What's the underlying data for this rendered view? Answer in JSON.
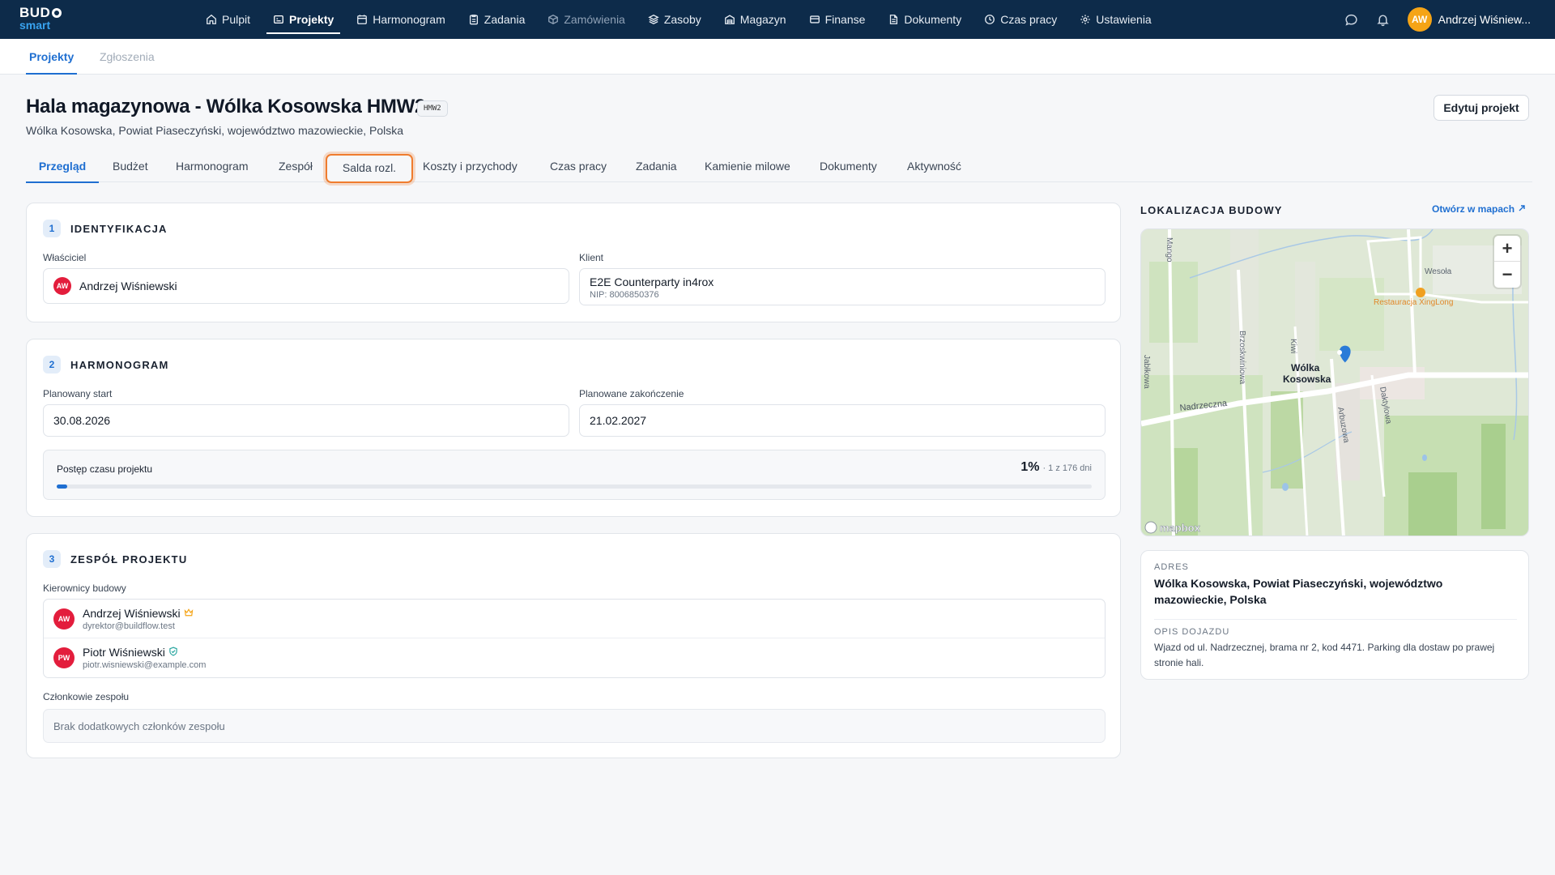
{
  "app": {
    "logo_top": "BUD",
    "logo_bottom": "smart"
  },
  "topnav": {
    "items": [
      {
        "label": "Pulpit",
        "icon": "home-icon"
      },
      {
        "label": "Projekty",
        "icon": "folder-icon"
      },
      {
        "label": "Harmonogram",
        "icon": "calendar-icon"
      },
      {
        "label": "Zadania",
        "icon": "clipboard-icon"
      },
      {
        "label": "Zamówienia",
        "icon": "box-icon"
      },
      {
        "label": "Zasoby",
        "icon": "layers-icon"
      },
      {
        "label": "Magazyn",
        "icon": "warehouse-icon"
      },
      {
        "label": "Finanse",
        "icon": "wallet-icon"
      },
      {
        "label": "Dokumenty",
        "icon": "documents-icon"
      },
      {
        "label": "Czas pracy",
        "icon": "clock-icon"
      },
      {
        "label": "Ustawienia",
        "icon": "gear-icon"
      }
    ],
    "user_initials": "AW",
    "user_name": "Andrzej Wiśniew..."
  },
  "subtabs": {
    "projects": "Projekty",
    "reports": "Zgłoszenia"
  },
  "project": {
    "title": "Hala magazynowa - Wólka Kosowska HMW2",
    "code": "HMW2",
    "address": "Wólka Kosowska, Powiat Piaseczyński, województwo mazowieckie, Polska",
    "edit_label": "Edytuj projekt"
  },
  "tabs": [
    "Przegląd",
    "Budżet",
    "Harmonogram",
    "Zespół",
    "Salda rozl.",
    "Koszty i przychody",
    "Czas pracy",
    "Zadania",
    "Kamienie milowe",
    "Dokumenty",
    "Aktywność"
  ],
  "identification": {
    "num": "1",
    "title": "IDENTYFIKACJA",
    "owner_label": "Właściciel",
    "owner_initials": "AW",
    "owner_name": "Andrzej Wiśniewski",
    "client_label": "Klient",
    "client_name": "E2E Counterparty in4rox",
    "client_nip": "NIP: 8006850376"
  },
  "schedule": {
    "num": "2",
    "title": "HARMONOGRAM",
    "start_label": "Planowany start",
    "start_value": "30.08.2026",
    "end_label": "Planowane zakończenie",
    "end_value": "21.02.2027",
    "progress_label": "Postęp czasu projektu",
    "progress_percent": "1%",
    "progress_detail": "· 1 z 176 dni",
    "progress_fraction": 0.01
  },
  "team": {
    "num": "3",
    "title": "ZESPÓŁ PROJEKTU",
    "managers_label": "Kierownicy budowy",
    "managers": [
      {
        "initials": "AW",
        "name": "Andrzej Wiśniewski",
        "email": "dyrektor@buildflow.test",
        "badge": "crown-icon"
      },
      {
        "initials": "PW",
        "name": "Piotr Wiśniewski",
        "email": "piotr.wisniewski@example.com",
        "badge": "shield-check-icon"
      }
    ],
    "members_label": "Członkowie zespołu",
    "members_empty": "Brak dodatkowych członków zespołu"
  },
  "location": {
    "title": "LOKALIZACJA BUDOWY",
    "open_link": "Otwórz w mapach",
    "map": {
      "labels": {
        "mango": "Mango",
        "wesola": "Wesoła",
        "restaurant": "Restauracja XingLong",
        "brzoskwiniowa": "Brzoskwiniowa",
        "kiwi": "Kiwi",
        "place_line1": "Wólka",
        "place_line2": "Kosowska",
        "nadrzeczna": "Nadrzeczna",
        "arbuzowa": "Arbuzowa",
        "daktylowa": "Daktylowa",
        "left_edge": "Jabłkowa",
        "attribution": "mapbox"
      },
      "zoom_in": "+",
      "zoom_out": "−"
    },
    "address_label": "ADRES",
    "address_value": "Wólka Kosowska, Powiat Piaseczyński, województwo mazowieckie, Polska",
    "directions_label": "OPIS DOJAZDU",
    "directions_value": "Wjazd od ul. Nadrzecznej, brama nr 2, kod 4471. Parking dla dostaw po prawej stronie hali."
  },
  "colors": {
    "nav_bg": "#0d2b4a",
    "accent": "#1f6fd1",
    "focus_ring": "#ef7c2e",
    "avatar_red": "#e31d3c",
    "avatar_orange": "#f5a416"
  }
}
